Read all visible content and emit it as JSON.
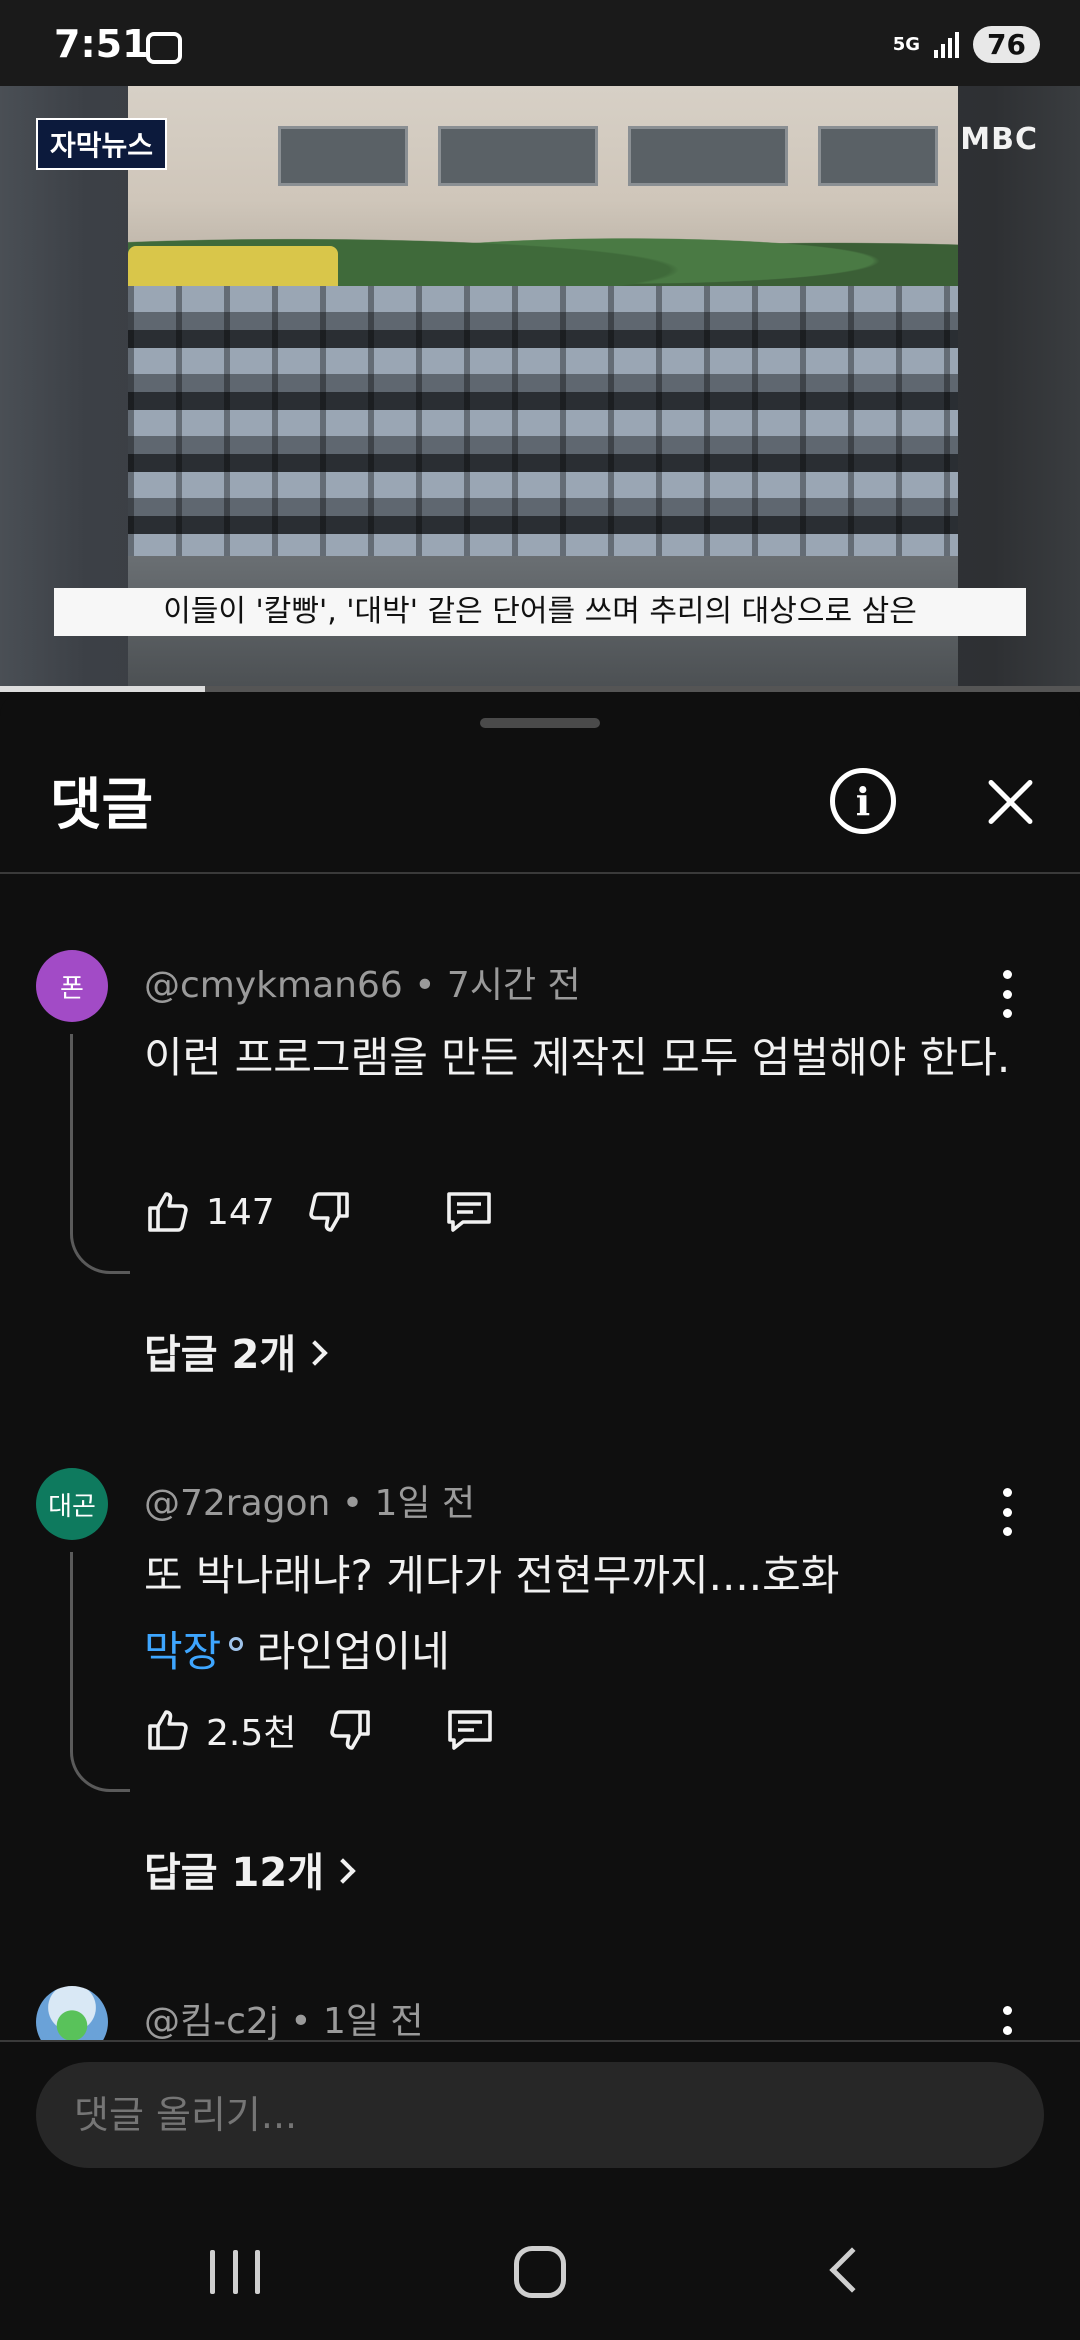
{
  "status_bar": {
    "time": "7:51",
    "network": "5G",
    "battery": "76"
  },
  "video": {
    "badge": "자막뉴스",
    "channel_logo": "MBC",
    "subtitle": "이들이 '칼빵', '대박' 같은 단어를 쓰며 추리의 대상으로 삼은",
    "progress": 0.19
  },
  "comments_panel": {
    "title": "댓글",
    "info_icon": "info-icon",
    "close_icon": "close-icon",
    "input_placeholder": "댓글 올리기...",
    "comments": [
      {
        "avatar_text": "폰",
        "avatar_color": "#a24bc6",
        "author": "@cmykman66",
        "time": "7시간 전",
        "text": "이런 프로그램을 만든 제작진 모두 엄벌해야 한다.",
        "likes": "147",
        "replies": "답글 2개"
      },
      {
        "avatar_text": "대곤",
        "avatar_color": "#0e7a5e",
        "author": "@72ragon",
        "time": "1일 전",
        "text_before": "또 박나래냐? 게다가 전현무까지....호화",
        "text_link": "막장",
        "text_after": "라인업이네",
        "likes": "2.5천",
        "replies": "답글 12개"
      },
      {
        "author": "@킴-c2j",
        "time": "1일 전"
      }
    ]
  },
  "nav": {
    "recent_icon": "recent-apps-icon",
    "home_icon": "home-icon",
    "back_icon": "back-icon"
  }
}
